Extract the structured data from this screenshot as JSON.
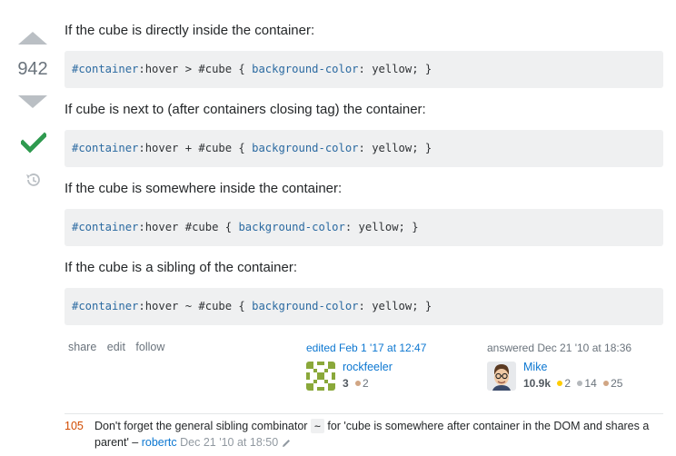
{
  "vote": {
    "count": "942"
  },
  "body": {
    "p1": "If the cube is directly inside the container:",
    "code1": {
      "sel": "#container",
      "mid": ":hover > #cube { ",
      "prop": "background-color",
      "rest": ": yellow; }"
    },
    "p2": "If cube is next to (after containers closing tag) the container:",
    "code2": {
      "sel": "#container",
      "mid": ":hover + #cube { ",
      "prop": "background-color",
      "rest": ": yellow; }"
    },
    "p3": "If the cube is somewhere inside the container:",
    "code3": {
      "sel": "#container",
      "mid": ":hover #cube { ",
      "prop": "background-color",
      "rest": ": yellow; }"
    },
    "p4": "If the cube is a sibling of the container:",
    "code4": {
      "sel": "#container",
      "mid": ":hover ~ #cube { ",
      "prop": "background-color",
      "rest": ": yellow; }"
    }
  },
  "menu": {
    "share": "share",
    "edit": "edit",
    "follow": "follow"
  },
  "editor": {
    "action": "edited Feb 1 '17 at 12:47",
    "name": "rockfeeler",
    "rep": "3",
    "bronze": "2"
  },
  "answerer": {
    "action": "answered Dec 21 '10 at 18:36",
    "name": "Mike",
    "rep": "10.9k",
    "gold": "2",
    "silver": "14",
    "bronze": "25"
  },
  "comment": {
    "score": "105",
    "text_before": "Don't forget the general sibling combinator ",
    "code": "~",
    "text_after": " for 'cube is somewhere after container in the DOM and shares a parent' – ",
    "user": "robertc",
    "date": "Dec 21 '10 at 18:50"
  },
  "colors": {
    "accent_link": "#0c77d1",
    "vote_arrow": "#babfc4",
    "accepted": "#2f9a4f",
    "comment_score": "#d14b00"
  }
}
